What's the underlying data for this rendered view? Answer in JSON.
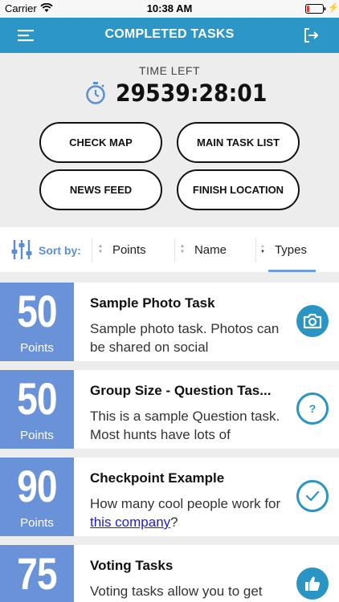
{
  "status": {
    "carrier": "Carrier",
    "time": "10:38 AM"
  },
  "nav": {
    "title": "COMPLETED TASKS"
  },
  "timer": {
    "label": "TIME LEFT",
    "value": "29539:28:01"
  },
  "buttons": {
    "check_map": "CHECK MAP",
    "main_task_list": "MAIN TASK LIST",
    "news_feed": "NEWS FEED",
    "finish_location": "FINISH LOCATION"
  },
  "sort": {
    "label": "Sort by:",
    "options": [
      {
        "label": "Points"
      },
      {
        "label": "Name"
      },
      {
        "label": "Types",
        "active": true
      }
    ]
  },
  "tasks": [
    {
      "points": "50",
      "points_word": "Points",
      "title": "Sample Photo Task",
      "desc": "Sample photo task. Photos can be shared on social",
      "type_icon": "camera-icon"
    },
    {
      "points": "50",
      "points_word": "Points",
      "title": "Group Size - Question Tas...",
      "desc": "This is a sample Question task. Most hunts have lots of",
      "type_icon": "question-icon"
    },
    {
      "points": "90",
      "points_word": "Points",
      "title": "Checkpoint Example",
      "desc_before": "How many cool people work for ",
      "desc_link": "this company",
      "desc_after": "?",
      "type_icon": "check-icon"
    },
    {
      "points": "75",
      "points_word": "Points",
      "title": "Voting Tasks",
      "desc": "Voting tasks allow you to get",
      "type_icon": "thumbs-up-icon"
    }
  ],
  "colors": {
    "nav": "#2c96c6",
    "points_box": "#6a92d8",
    "accent": "#2a94c2",
    "sort_accent": "#5b8fd4"
  }
}
